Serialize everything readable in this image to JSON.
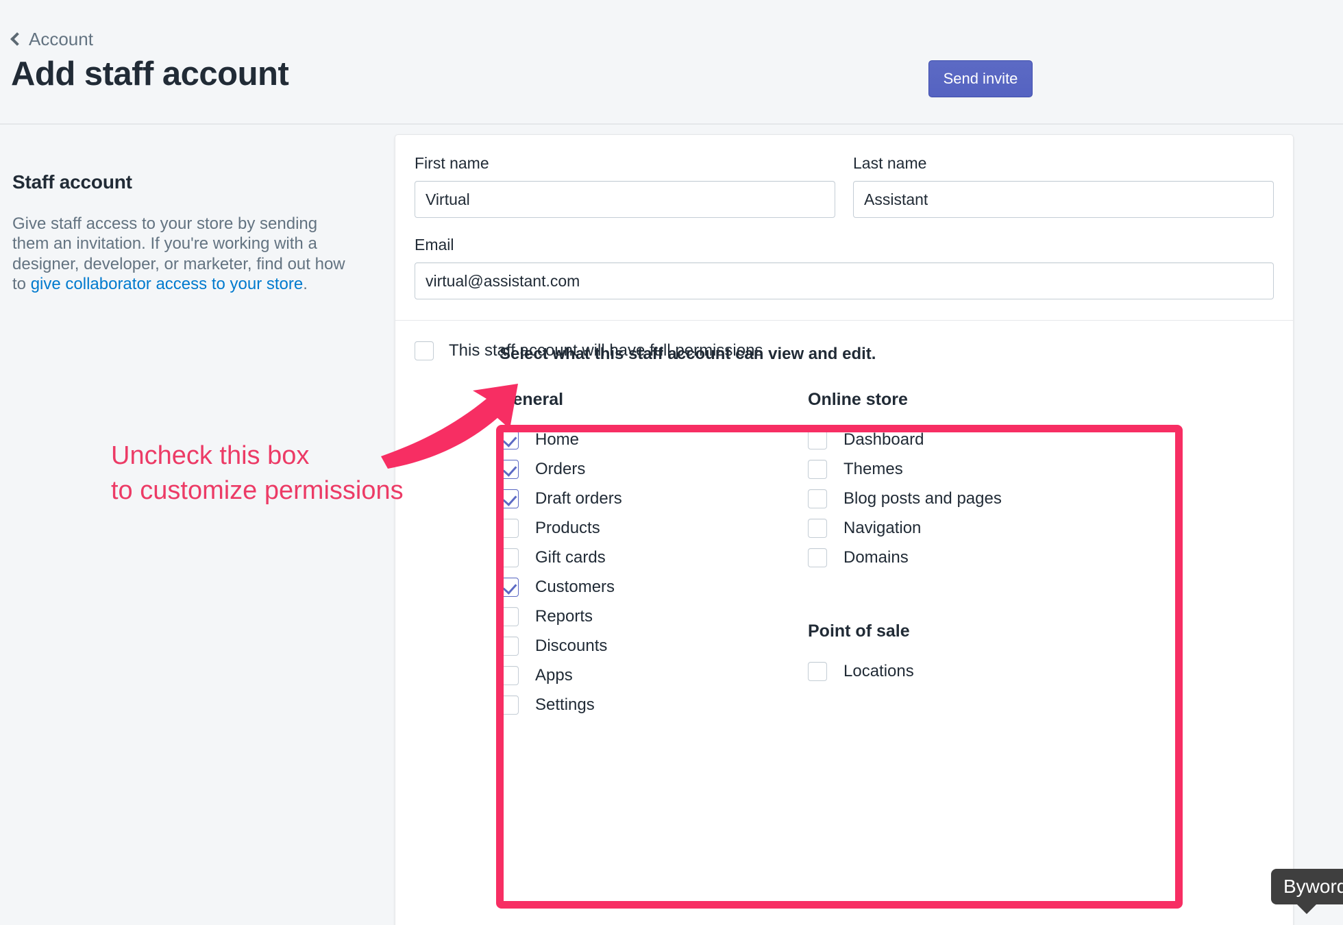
{
  "header": {
    "breadcrumb": "Account",
    "title": "Add staff account",
    "primary_button": "Send invite",
    "accent_color": "#5c6ac4"
  },
  "sidebar": {
    "heading": "Staff account",
    "description_part1": "Give staff access to your store by sending them an invitation. If you're working with a designer, developer, or marketer, find out how to ",
    "link_text": "give collaborator access to your store",
    "description_part2": "."
  },
  "form": {
    "first_name": {
      "label": "First name",
      "value": "Virtual",
      "placeholder": "First name"
    },
    "last_name": {
      "label": "Last name",
      "value": "Assistant",
      "placeholder": "Last name"
    },
    "email": {
      "label": "Email",
      "value": "virtual@assistant.com",
      "placeholder": "Email"
    }
  },
  "full_permissions": {
    "label": "This staff account will have full permissions",
    "checked": false
  },
  "permissions": {
    "intro": "Select what this staff account can view and edit.",
    "groups": [
      {
        "title": "General",
        "items": [
          {
            "label": "Home",
            "checked": true
          },
          {
            "label": "Orders",
            "checked": true
          },
          {
            "label": "Draft orders",
            "checked": true
          },
          {
            "label": "Products",
            "checked": false
          },
          {
            "label": "Gift cards",
            "checked": false
          },
          {
            "label": "Customers",
            "checked": true
          },
          {
            "label": "Reports",
            "checked": false
          },
          {
            "label": "Discounts",
            "checked": false
          },
          {
            "label": "Apps",
            "checked": false
          },
          {
            "label": "Settings",
            "checked": false
          }
        ]
      },
      {
        "title": "Online store",
        "items": [
          {
            "label": "Dashboard",
            "checked": false
          },
          {
            "label": "Themes",
            "checked": false
          },
          {
            "label": "Blog posts and pages",
            "checked": false
          },
          {
            "label": "Navigation",
            "checked": false
          },
          {
            "label": "Domains",
            "checked": false
          }
        ]
      },
      {
        "title": "Point of sale",
        "items": [
          {
            "label": "Locations",
            "checked": false
          }
        ]
      }
    ]
  },
  "annotation": {
    "text": "Uncheck this box\nto customize permissions",
    "color": "#ec3b66",
    "highlight_color": "#f72e63"
  },
  "tooltip": {
    "text": "Byword"
  }
}
